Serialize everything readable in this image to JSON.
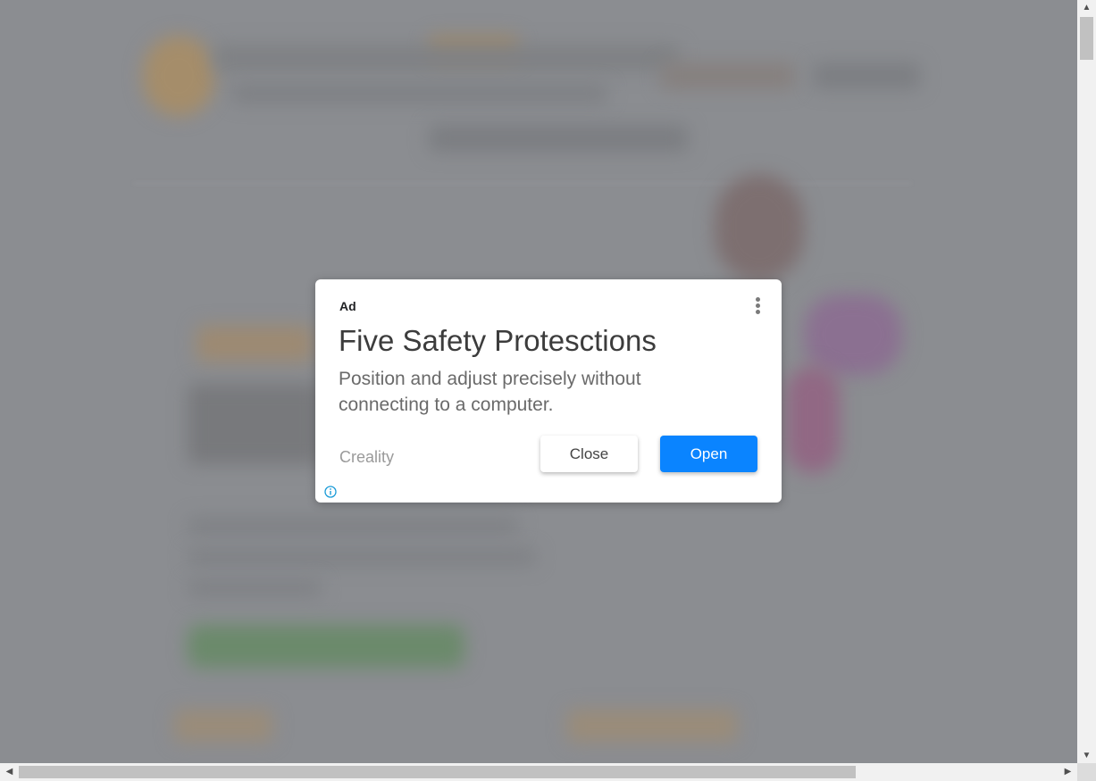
{
  "ad": {
    "label": "Ad",
    "title": "Five Safety Protesctions",
    "description": "Position and adjust precisely without connecting to a computer.",
    "advertiser": "Creality",
    "close_label": "Close",
    "open_label": "Open",
    "menu_icon": "more-vert-icon",
    "info_icon": "info-icon"
  },
  "colors": {
    "overlay": "#8a8c90",
    "open_button": "#0a84ff",
    "info_icon": "#1a9bd7"
  },
  "scrollbars": {
    "up_arrow": "▲",
    "down_arrow": "▼",
    "left_arrow": "◀",
    "right_arrow": "▶"
  }
}
